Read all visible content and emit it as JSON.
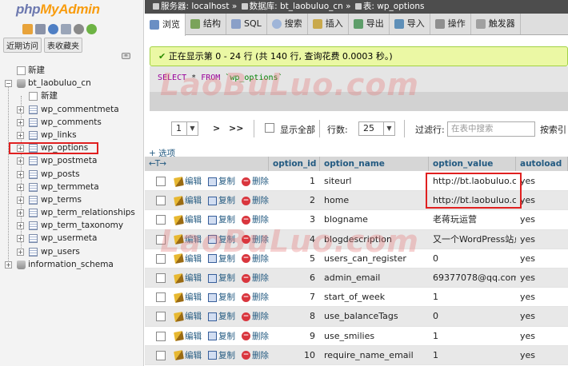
{
  "app": {
    "logo_php": "php",
    "logo_my": "My",
    "logo_admin": "Admin",
    "recent_label": "近期访问",
    "favorites_label": "表收藏夹"
  },
  "tree": {
    "new_top": "新建",
    "db_name": "bt_laobuluo_cn",
    "new_table": "新建",
    "tables": [
      "wp_commentmeta",
      "wp_comments",
      "wp_links",
      "wp_options",
      "wp_postmeta",
      "wp_posts",
      "wp_termmeta",
      "wp_terms",
      "wp_term_relationships",
      "wp_term_taxonomy",
      "wp_usermeta",
      "wp_users"
    ],
    "other_db": "information_schema"
  },
  "breadcrumb": {
    "server": "服务器: localhost",
    "database": "数据库: bt_laobuluo_cn",
    "table": "表: wp_options"
  },
  "tabs": [
    "浏览",
    "结构",
    "SQL",
    "搜索",
    "插入",
    "导出",
    "导入",
    "操作",
    "触发器"
  ],
  "message": "正在显示第 0 - 24 行 (共 140 行, 查询花费 0.0003 秒。)",
  "sql": {
    "select": "SELECT",
    "star": " * ",
    "from": "FROM",
    "table": " `wp_options`"
  },
  "pager": {
    "page": "1",
    "next": ">",
    "last": ">>",
    "show_all": "显示全部",
    "rows_label": "行数:",
    "rows_value": "25",
    "filter_label": "过滤行:",
    "filter_placeholder": "在表中搜索",
    "sort_label": "按索引"
  },
  "options_link": "+ 选项",
  "arrows": "←T→",
  "columns": [
    "option_id",
    "option_name",
    "option_value",
    "autoload"
  ],
  "actions": {
    "edit": "编辑",
    "copy": "复制",
    "delete": "删除"
  },
  "rows": [
    {
      "id": "1",
      "name": "siteurl",
      "value": "http://bt.laobuluo.cn",
      "autoload": "yes"
    },
    {
      "id": "2",
      "name": "home",
      "value": "http://bt.laobuluo.cn",
      "autoload": "yes"
    },
    {
      "id": "3",
      "name": "blogname",
      "value": "老蒋玩运营",
      "autoload": "yes"
    },
    {
      "id": "4",
      "name": "blogdescription",
      "value": "又一个WordPress站点",
      "autoload": "yes"
    },
    {
      "id": "5",
      "name": "users_can_register",
      "value": "0",
      "autoload": "yes"
    },
    {
      "id": "6",
      "name": "admin_email",
      "value": "69377078@qq.com",
      "autoload": "yes"
    },
    {
      "id": "7",
      "name": "start_of_week",
      "value": "1",
      "autoload": "yes"
    },
    {
      "id": "8",
      "name": "use_balanceTags",
      "value": "0",
      "autoload": "yes"
    },
    {
      "id": "9",
      "name": "use_smilies",
      "value": "1",
      "autoload": "yes"
    },
    {
      "id": "10",
      "name": "require_name_email",
      "value": "1",
      "autoload": "yes"
    }
  ],
  "watermark": "LaoBuLuo.com"
}
